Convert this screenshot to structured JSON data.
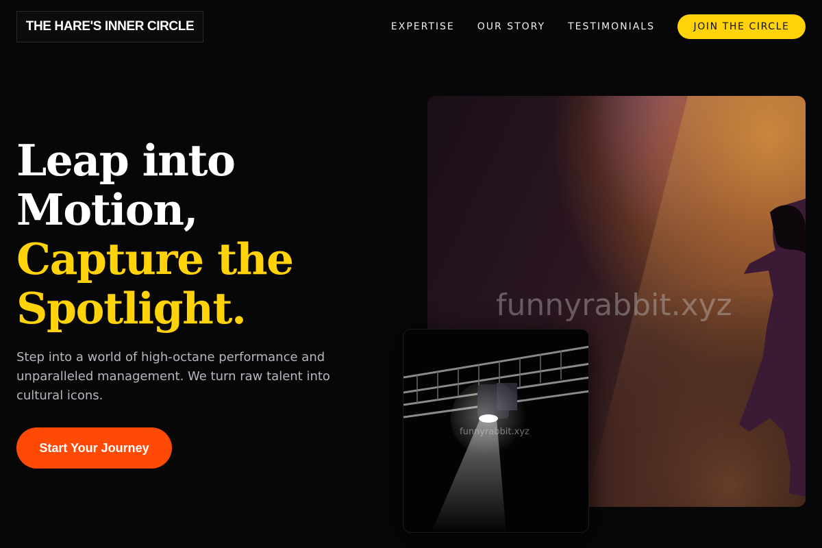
{
  "header": {
    "logo": "THE HARE'S INNER CIRCLE",
    "nav": [
      "EXPERTISE",
      "OUR STORY",
      "TESTIMONIALS"
    ],
    "cta": "JOIN THE CIRCLE"
  },
  "hero": {
    "title_line1": "Leap into",
    "title_line2": "Motion,",
    "title_line3": "Capture the",
    "title_line4": "Spotlight.",
    "subtitle": "Step into a world of high-octane performance and unparalleled management. We turn raw talent into cultural icons.",
    "cta": "Start Your Journey"
  },
  "media": {
    "watermark_main": "funnyrabbit.xyz",
    "watermark_small": "funnyrabbit.xyz"
  },
  "colors": {
    "background": "#070707",
    "accent_yellow": "#ffd20a",
    "accent_orange": "#ff4a06",
    "subtitle_gray": "#b4b8c0"
  }
}
